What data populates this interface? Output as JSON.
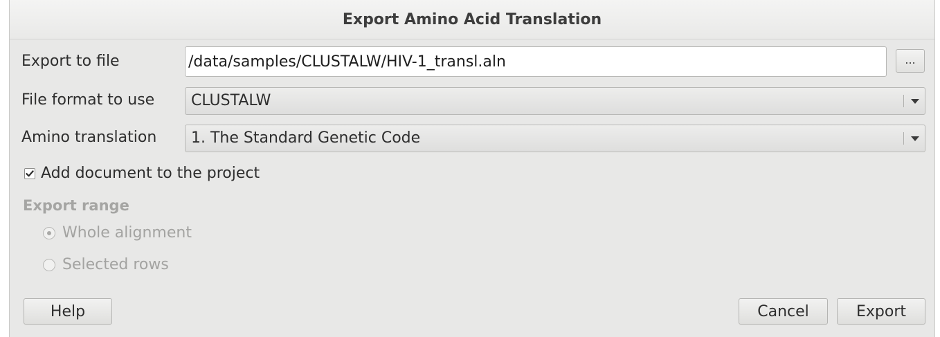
{
  "dialog": {
    "title": "Export Amino Acid Translation"
  },
  "export_file": {
    "label": "Export to file",
    "value": "/data/samples/CLUSTALW/HIV-1_transl.aln",
    "browse_label": "..."
  },
  "file_format": {
    "label": "File format to use",
    "selected": "CLUSTALW"
  },
  "amino_translation": {
    "label": "Amino translation",
    "selected": "1. The Standard Genetic Code"
  },
  "add_to_project": {
    "label": "Add document to the project",
    "checked": true
  },
  "export_range": {
    "title": "Export range",
    "options": [
      {
        "label": "Whole alignment",
        "selected": true
      },
      {
        "label": "Selected rows",
        "selected": false
      }
    ]
  },
  "buttons": {
    "help": "Help",
    "cancel": "Cancel",
    "export": "Export"
  },
  "colors": {
    "dialog_bg": "#e8e8e7",
    "disabled_text": "#a3a3a1"
  }
}
